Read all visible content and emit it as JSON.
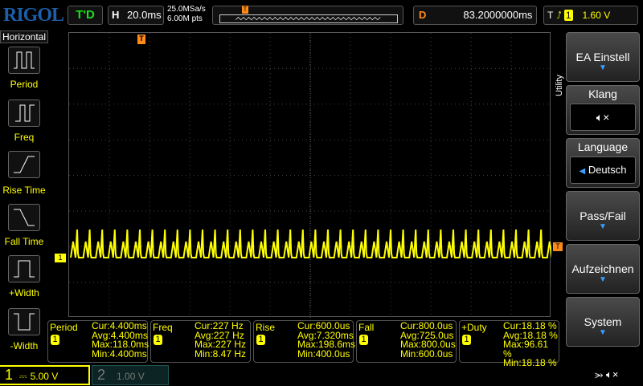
{
  "header": {
    "logo": "RIGOL",
    "run_state": "T'D",
    "timebase_label": "H",
    "timebase": "20.0ms",
    "sample_rate": "25.0MSa/s",
    "memory_depth": "6.00M pts",
    "delay_label": "D",
    "delay": "83.2000000ms",
    "trigger_label": "T",
    "trigger_source": "1",
    "trigger_level": "1.60 V"
  },
  "left_menu": {
    "title": "Horizontal",
    "items": [
      {
        "label": "Period"
      },
      {
        "label": "Freq"
      },
      {
        "label": "Rise Time"
      },
      {
        "label": "Fall Time"
      },
      {
        "label": "+Width"
      },
      {
        "label": "-Width"
      }
    ]
  },
  "right_menu": {
    "title": "Utility",
    "items": [
      {
        "label": "EA Einstell"
      },
      {
        "label": "Klang"
      },
      {
        "label": "Language",
        "value": "Deutsch"
      },
      {
        "label": "Pass/Fail"
      },
      {
        "label": "Aufzeichnen"
      },
      {
        "label": "System"
      }
    ]
  },
  "markers": {
    "trigger": "T",
    "channel": "1"
  },
  "measurements": [
    {
      "name": "Period",
      "channel": "1",
      "cur": "Cur:4.400ms",
      "avg": "Avg:4.400ms",
      "max": "Max:118.0ms",
      "min": "Min:4.400ms"
    },
    {
      "name": "Freq",
      "channel": "1",
      "cur": "Cur:227 Hz",
      "avg": "Avg:227 Hz",
      "max": "Max:227 Hz",
      "min": "Min:8.47 Hz"
    },
    {
      "name": "Rise",
      "channel": "1",
      "cur": "Cur:600.0us",
      "avg": "Avg:7.320ms",
      "max": "Max:198.6ms",
      "min": "Min:400.0us"
    },
    {
      "name": "Fall",
      "channel": "1",
      "cur": "Cur:800.0us",
      "avg": "Avg:725.0us",
      "max": "Max:800.0us",
      "min": "Min:600.0us"
    },
    {
      "name": "+Duty",
      "channel": "1",
      "cur": "Cur:18.18 %",
      "avg": "Avg:18.18 %",
      "max": "Max:96.61 %",
      "min": "Min:18.18 %"
    }
  ],
  "channels": [
    {
      "number": "1",
      "scale": "5.00 V",
      "color": "#ffff00"
    },
    {
      "number": "2",
      "scale": "1.00 V",
      "color": "#00c0c0"
    }
  ],
  "colors": {
    "ch1": "#ffff00",
    "accent": "#ff8c1a"
  }
}
